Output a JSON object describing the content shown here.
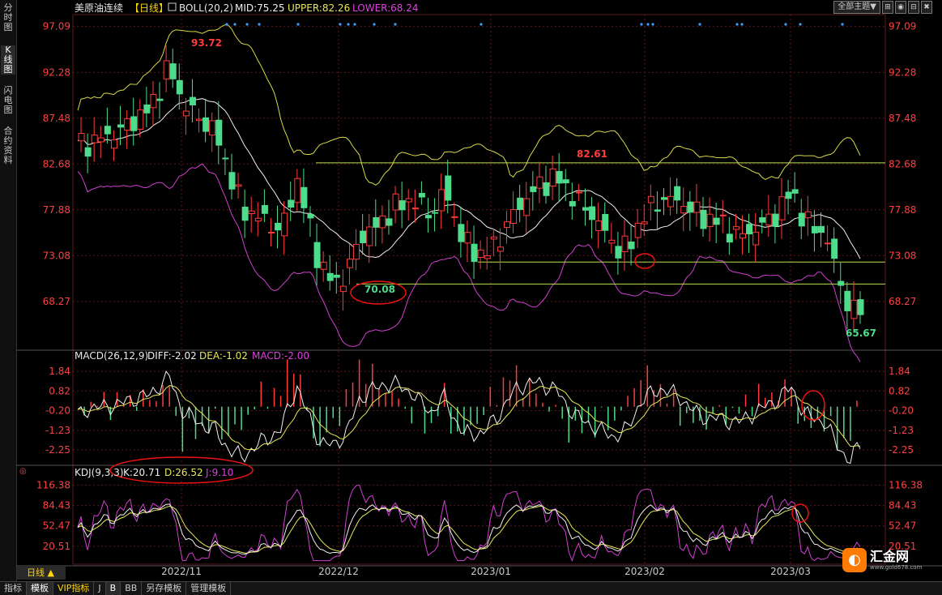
{
  "side_tabs": [
    {
      "label": "分时图"
    },
    {
      "label": "K线图"
    },
    {
      "label": "闪电图"
    },
    {
      "label": "合约资料"
    }
  ],
  "toolbar": {
    "theme": "全部主题▼",
    "btns": [
      "⊞",
      "◉",
      "⊟",
      "✖"
    ]
  },
  "header": {
    "symbol": "美原油连续",
    "period": "【日线】",
    "boll": "BOLL(20,2)",
    "mid": "MID:75.25",
    "upper": "UPPER:82.26",
    "lower": "LOWER:68.24"
  },
  "macd_header": {
    "name": "MACD(26,12,9)",
    "diff": "DIFF:-2.02",
    "dea": "DEA:-1.02",
    "macd": "MACD:-2.00"
  },
  "kdj_header": {
    "name": "KDJ(9,3,3)",
    "k": "K:20.71",
    "d": "D:26.52",
    "j": "J:9.10"
  },
  "colors": {
    "up": "#ff3b3b",
    "down": "#4ddc8c",
    "upper": "#d8d84a",
    "mid": "#f0f0f0",
    "lower": "#d040d0",
    "dea": "#e8e85a",
    "grid": "#5a1a1a",
    "axis": "#ff4040",
    "circle": "#ee1111",
    "support": "#b8e050"
  },
  "chart_data": [
    {
      "type": "candlestick",
      "title": "美原油连续【日线】",
      "y_ticks": [
        97.09,
        92.28,
        87.48,
        82.68,
        77.88,
        73.08,
        68.27
      ],
      "ylim": [
        63.5,
        98
      ],
      "x_ticks": [
        "2022/11",
        "2022/12",
        "2023/01",
        "2023/02",
        "2023/03"
      ],
      "annotations": [
        "93.72",
        "82.61",
        "70.08",
        "65.67"
      ],
      "support_lines": [
        82.8,
        72.4,
        70.1
      ],
      "series": [
        {
          "name": "BOLL"
        },
        {
          "name": "MID"
        },
        {
          "name": "UPPER"
        },
        {
          "name": "LOWER"
        }
      ]
    },
    {
      "type": "bar",
      "title": "MACD(26,12,9)",
      "y_ticks": [
        1.84,
        0.82,
        -0.2,
        -1.23,
        -2.25
      ],
      "ylim": [
        -2.8,
        2.1
      ],
      "series": [
        {
          "name": "DIFF"
        },
        {
          "name": "DEA"
        },
        {
          "name": "MACD"
        }
      ]
    },
    {
      "type": "line",
      "title": "KDJ(9,3,3)",
      "y_ticks": [
        116.38,
        84.43,
        52.47,
        20.51
      ],
      "ylim": [
        -5,
        122
      ],
      "series": [
        {
          "name": "K"
        },
        {
          "name": "D"
        },
        {
          "name": "J"
        }
      ]
    }
  ],
  "bottom_tabs": [
    {
      "label": "指标"
    },
    {
      "label": "模板"
    },
    {
      "label": "VIP指标"
    },
    {
      "label": "J"
    },
    {
      "label": "B"
    },
    {
      "label": "BB"
    },
    {
      "label": "另存模板"
    },
    {
      "label": "管理模板"
    }
  ],
  "period_tab": "日线 ▲",
  "logo": {
    "icon": "◐",
    "name": "汇金网",
    "url": "www.gold678.com"
  }
}
